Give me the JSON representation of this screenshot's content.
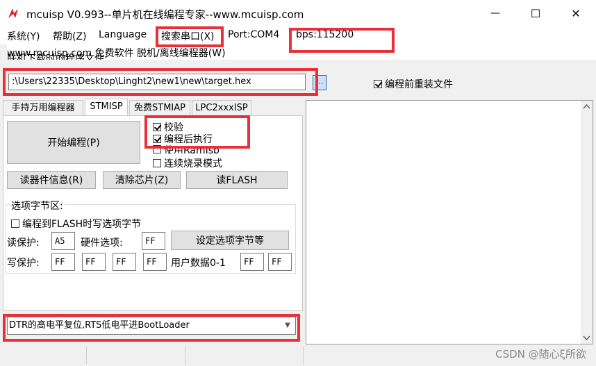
{
  "window": {
    "title": "mcuisp V0.993--单片机在线编程专家--www.mcuisp.com",
    "minimize": "—",
    "maximize": "☐",
    "close": "✕"
  },
  "menu": {
    "items": [
      "系统(Y)",
      "帮助(Z)",
      "Language",
      "搜索串口(X)",
      "Port:COM4",
      "bps:115200"
    ],
    "line2": "www.mcuisp.com 免费软件 脱机/离线编程器(W)",
    "partial_label": "联机下载时的程序文件:"
  },
  "file": {
    "path": ":\\Users\\22335\\Desktop\\Linght2\\new1\\new\\target.hex",
    "reload_label": "编程前重装文件",
    "reload_checked": true
  },
  "tabs": [
    "手持万用编程器",
    "STMISP",
    "免费STMIAP",
    "LPC2xxxISP"
  ],
  "panel": {
    "start_button": "开始编程(P)",
    "options": [
      {
        "label": "校验",
        "checked": true
      },
      {
        "label": "编程后执行",
        "checked": true
      },
      {
        "label": "使用RamIsp",
        "checked": false
      },
      {
        "label": "连续烧录模式",
        "checked": false
      }
    ],
    "read_info_button": "读器件信息(R)",
    "erase_button": "清除芯片(Z)",
    "read_flash_button": "读FLASH"
  },
  "option_bytes": {
    "group_title": "选项字节区:",
    "write_opt_label": "编程到FLASH时写选项字节",
    "write_opt_checked": false,
    "read_protect_label": "读保护:",
    "read_protect_value": "A5",
    "hw_option_label": "硬件选项:",
    "hw_option_value": "FF",
    "set_button": "设定选项字节等",
    "write_protect_label": "写保护:",
    "write_protect_values": [
      "FF",
      "FF",
      "FF",
      "FF"
    ],
    "user_data_label": "用户数据0-1",
    "user_data_values": [
      "FF",
      "FF"
    ]
  },
  "bootmode": {
    "selected": "DTR的高电平复位,RTS低电平进BootLoader"
  },
  "watermark": "CSDN @随心ξ所欲",
  "colors": {
    "highlight": "#e8303a",
    "window_bg": "#f0f0f0"
  }
}
